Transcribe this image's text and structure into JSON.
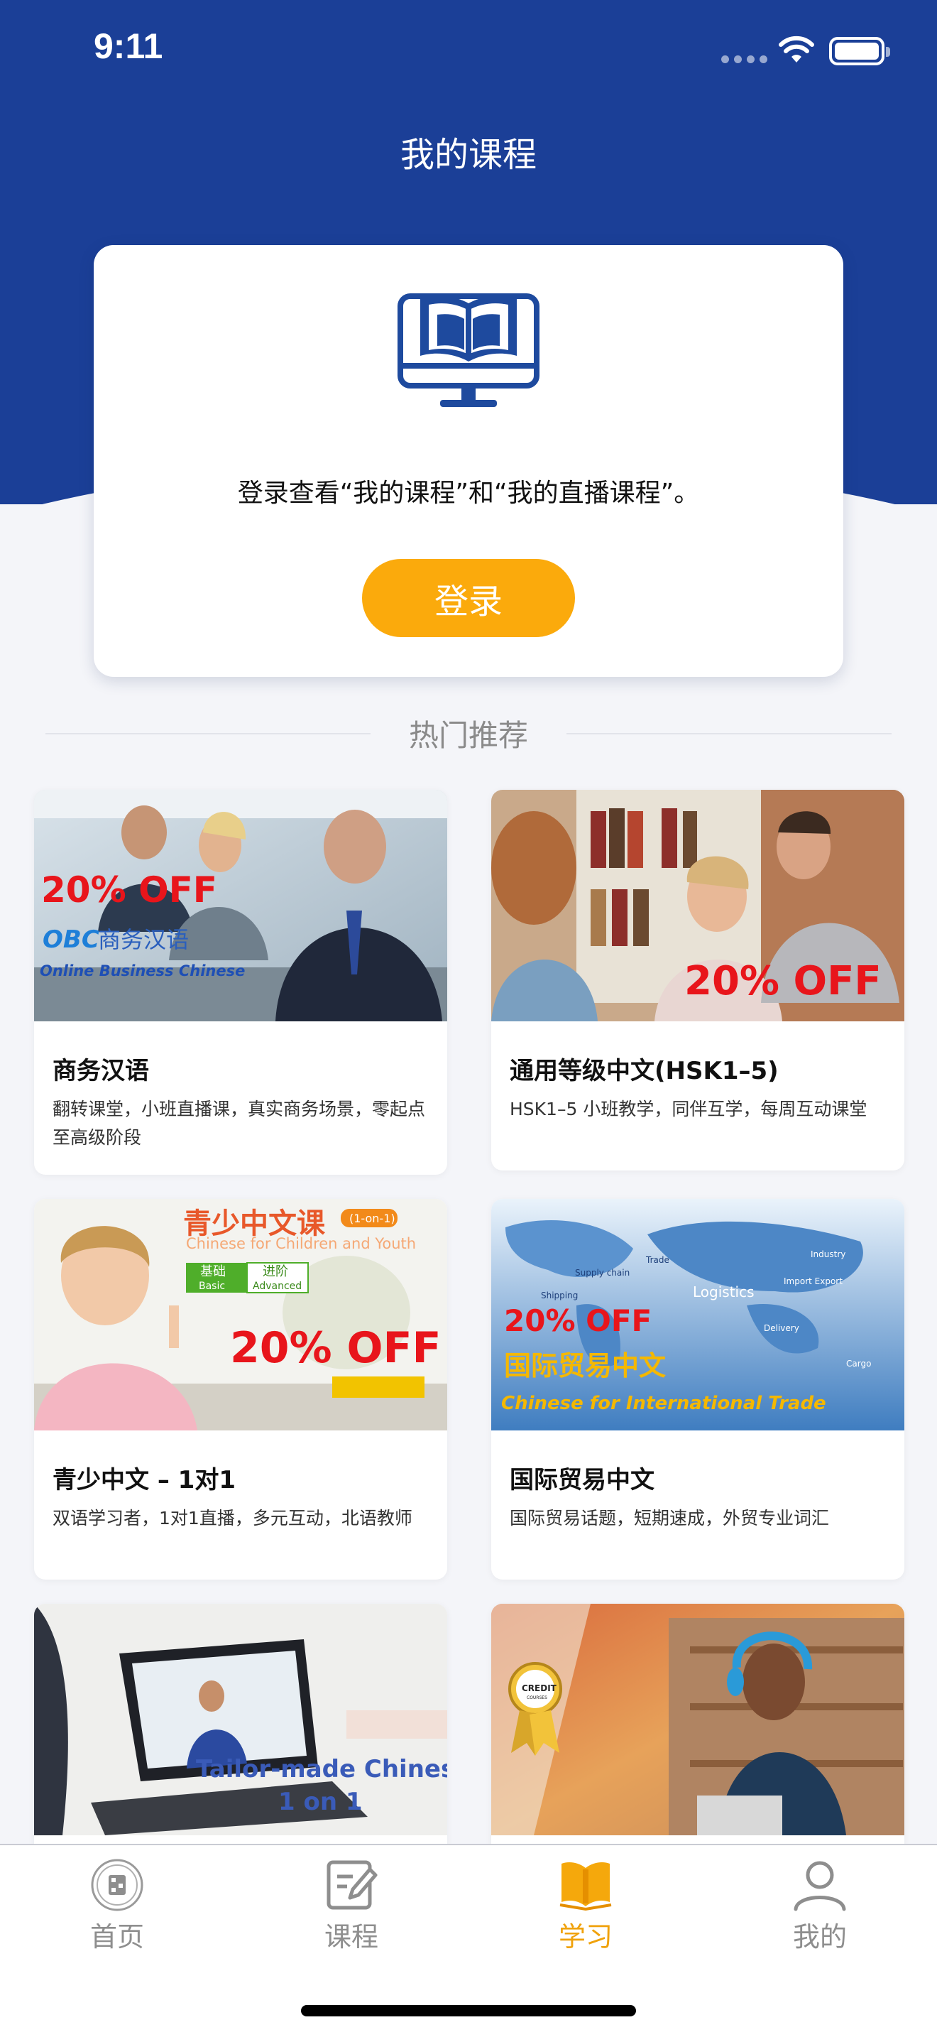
{
  "status_bar": {
    "time": "9:11"
  },
  "header": {
    "title": "我的课程"
  },
  "login_card": {
    "icon": "book-monitor-icon",
    "prompt": "登录查看“我的课程”和“我的直播课程”。",
    "login_label": "登录"
  },
  "section": {
    "title": "热门推荐"
  },
  "courses": [
    {
      "title": "商务汉语",
      "description": "翻转课堂，小班直播课，真实商务场景，零起点至高级阶段",
      "banner": {
        "discount": "20% OFF",
        "brand": "OBC",
        "name_cn": "商务汉语",
        "name_en": "Online Business Chinese"
      }
    },
    {
      "title": "通用等级中文(HSK1–5)",
      "description": "HSK1–5 小班教学，同伴互学，每周互动课堂",
      "banner": {
        "discount": "20% OFF"
      }
    },
    {
      "title": "青少中文 – 1对1",
      "description": "双语学习者，1对1直播，多元互动，北语教师",
      "banner": {
        "name_cn": "青少中文课",
        "tag": "(1-on-1)",
        "name_en": "Chinese for Children and Youth",
        "level1_cn": "基础",
        "level1_en": "Basic",
        "level2_cn": "进阶",
        "level2_en": "Advanced",
        "discount": "20% OFF"
      }
    },
    {
      "title": "国际贸易中文",
      "description": "国际贸易话题，短期速成，外贸专业词汇",
      "banner": {
        "discount": "20% OFF",
        "name_cn": "国际贸易中文",
        "name_en": "Chinese for International Trade",
        "words": [
          "Trade",
          "Industry",
          "Supply chain",
          "Import Export",
          "Shipping",
          "Logistics",
          "Delivery",
          "Cargo"
        ]
      }
    },
    {
      "title": "",
      "description": "",
      "banner": {
        "line1": "Tailor-made Chinese",
        "line2": "1 on 1"
      }
    },
    {
      "title": "",
      "description": "",
      "banner": {
        "badge": "CREDIT",
        "badge_sub": "COURSES"
      }
    }
  ],
  "tab_bar": {
    "items": [
      {
        "label": "首页",
        "icon": "university-seal-icon",
        "active": false
      },
      {
        "label": "课程",
        "icon": "edit-note-icon",
        "active": false
      },
      {
        "label": "学习",
        "icon": "open-book-icon",
        "active": true
      },
      {
        "label": "我的",
        "icon": "person-icon",
        "active": false
      }
    ]
  },
  "colors": {
    "brand_blue": "#1b3f97",
    "accent_orange": "#fbaa0c",
    "active_tab": "#f0a20c"
  }
}
